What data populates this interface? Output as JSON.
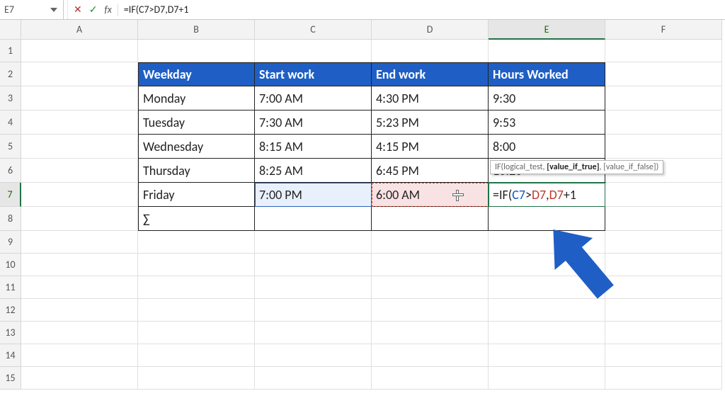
{
  "namebox": "E7",
  "formula_plain": "=IF(C7>D7,D7+1",
  "columns": [
    "A",
    "B",
    "C",
    "D",
    "E",
    "F"
  ],
  "rowcount": 15,
  "active": {
    "col": "E",
    "row": 7
  },
  "tooltip": {
    "before": "IF(logical_test, ",
    "bold": "[value_if_true]",
    "after": ", [value_if_false])"
  },
  "table": {
    "headers": [
      "Weekday",
      "Start work",
      "End work",
      "Hours Worked"
    ],
    "rows": [
      [
        "Monday",
        "7:00 AM",
        "4:30 PM",
        "9:30"
      ],
      [
        "Tuesday",
        "7:30 AM",
        "5:23 PM",
        "9:53"
      ],
      [
        "Wednesday",
        "8:15 AM",
        "4:15 PM",
        "8:00"
      ],
      [
        "Thursday",
        "8:25 AM",
        "6:45 PM",
        "10:20"
      ],
      [
        "Friday",
        "7:00 PM",
        "6:00 AM",
        ""
      ]
    ],
    "sigma": "∑"
  },
  "formula_parts": [
    {
      "t": "=IF(",
      "c": "blk"
    },
    {
      "t": "C7",
      "c": "blue"
    },
    {
      "t": ">",
      "c": "blk"
    },
    {
      "t": "D7",
      "c": "red"
    },
    {
      "t": ",",
      "c": "blk"
    },
    {
      "t": "D7",
      "c": "red"
    },
    {
      "t": "+1",
      "c": "blk"
    }
  ],
  "chart_data": {
    "type": "table",
    "title": "",
    "columns": [
      "Weekday",
      "Start work",
      "End work",
      "Hours Worked"
    ],
    "rows": [
      {
        "Weekday": "Monday",
        "Start work": "7:00 AM",
        "End work": "4:30 PM",
        "Hours Worked": "9:30"
      },
      {
        "Weekday": "Tuesday",
        "Start work": "7:30 AM",
        "End work": "5:23 PM",
        "Hours Worked": "9:53"
      },
      {
        "Weekday": "Wednesday",
        "Start work": "8:15 AM",
        "End work": "4:15 PM",
        "Hours Worked": "8:00"
      },
      {
        "Weekday": "Thursday",
        "Start work": "8:25 AM",
        "End work": "6:45 PM",
        "Hours Worked": "10:20"
      },
      {
        "Weekday": "Friday",
        "Start work": "7:00 PM",
        "End work": "6:00 AM",
        "Hours Worked": null
      }
    ]
  }
}
